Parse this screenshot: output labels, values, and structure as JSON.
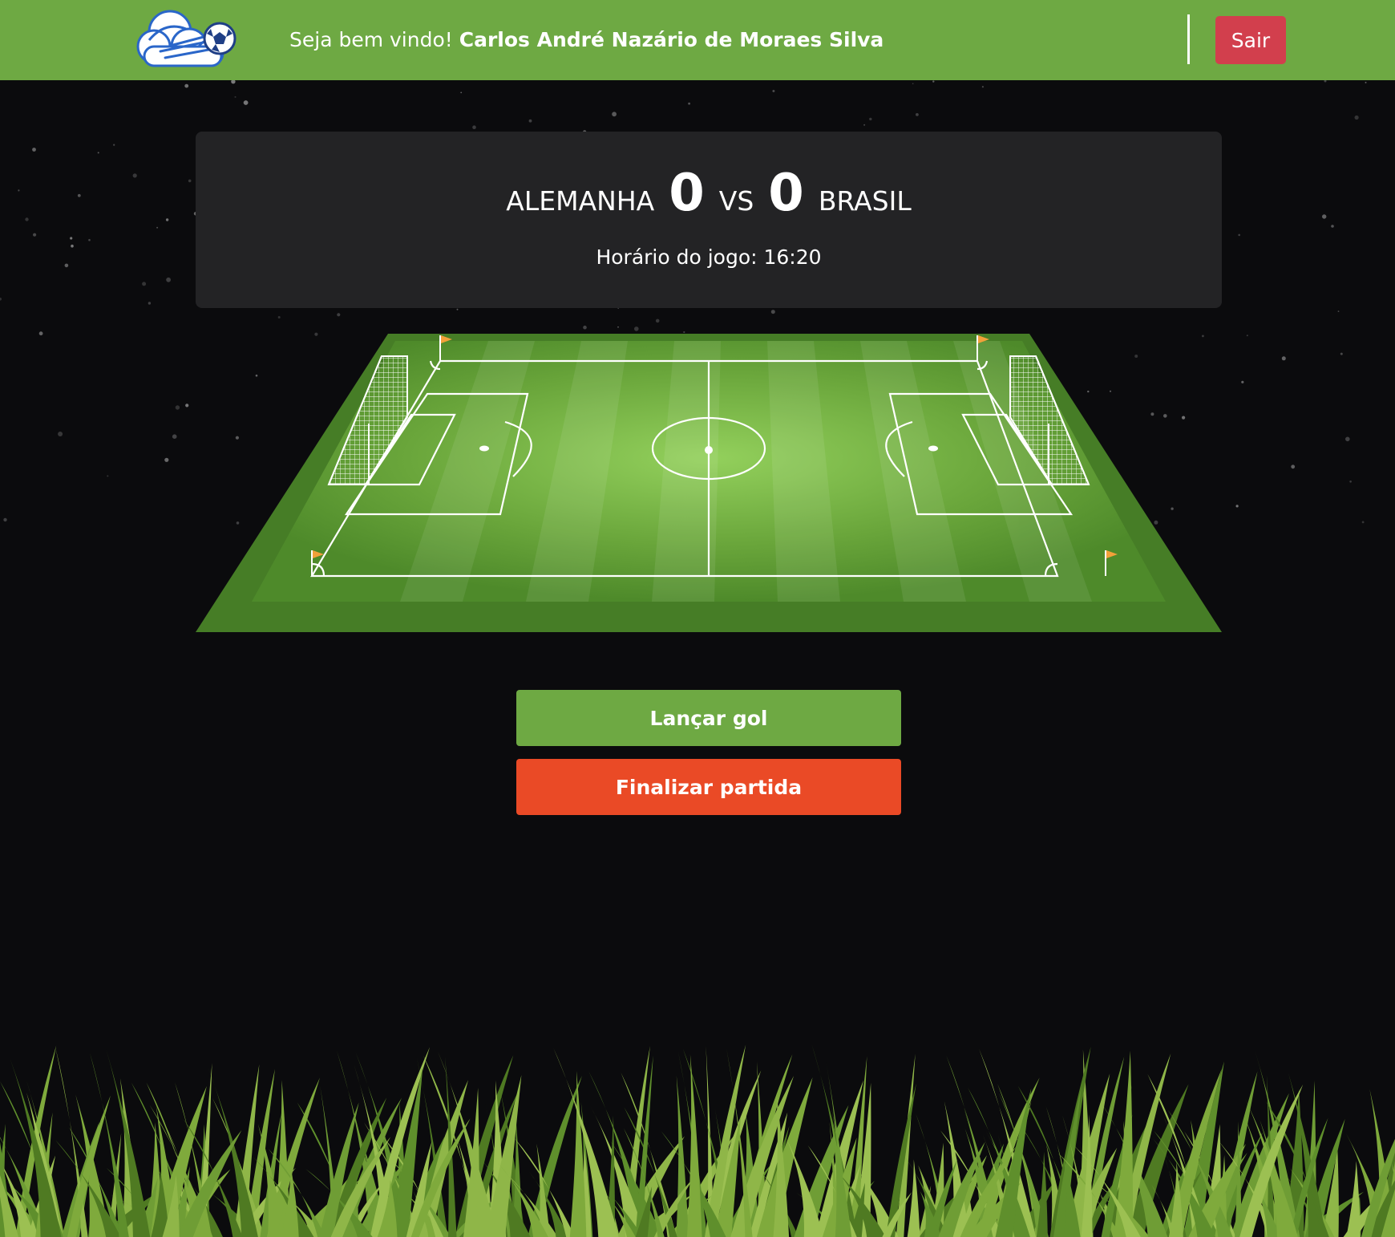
{
  "header": {
    "welcome_text": "Seja bem vindo!",
    "user_name": "Carlos André Nazário de Moraes Silva",
    "logout_label": "Sair"
  },
  "match": {
    "home_team": "ALEMANHA",
    "home_score": "0",
    "vs_label": "VS",
    "away_score": "0",
    "away_team": "BRASIL",
    "time_text": "Horário do jogo: 16:20"
  },
  "actions": {
    "goal_label": "Lançar gol",
    "end_label": "Finalizar partida"
  },
  "colors": {
    "brand_green": "#6ea943",
    "logout_red": "#d23f4d",
    "end_orange": "#ea4a26",
    "panel": "#232325",
    "background": "#0b0b0d"
  }
}
